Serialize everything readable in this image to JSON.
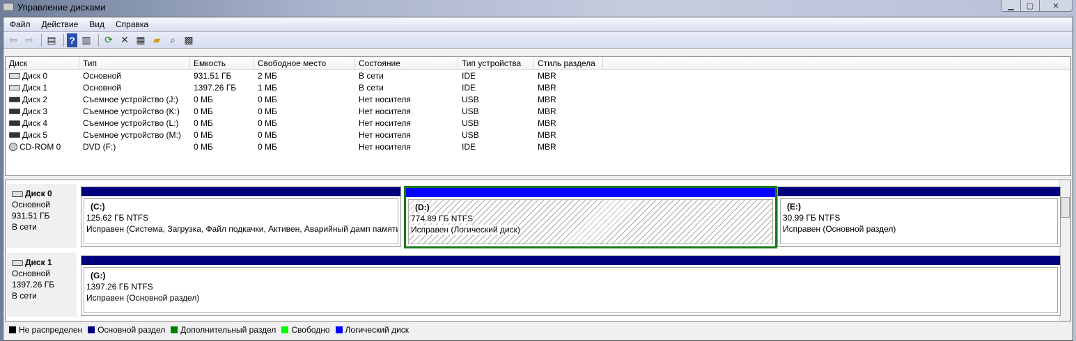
{
  "window": {
    "title": "Управление дисками",
    "controls": [
      "minimize",
      "maximize",
      "close"
    ]
  },
  "menu": [
    "Файл",
    "Действие",
    "Вид",
    "Справка"
  ],
  "toolbar": [
    "back-icon",
    "forward-icon",
    "console-tree-icon",
    "help-icon",
    "action-pane-icon",
    "refresh-icon",
    "delete-icon",
    "properties-icon",
    "open-icon",
    "search-icon",
    "settings-icon"
  ],
  "table": {
    "columns": [
      "Диск",
      "Тип",
      "Емкость",
      "Свободное место",
      "Состояние",
      "Тип устройства",
      "Стиль раздела"
    ],
    "rows": [
      [
        "Диск 0",
        "Основной",
        "931.51 ГБ",
        "2 МБ",
        "В сети",
        "IDE",
        "MBR"
      ],
      [
        "Диск 1",
        "Основной",
        "1397.26 ГБ",
        "1 МБ",
        "В сети",
        "IDE",
        "MBR"
      ],
      [
        "Диск 2",
        "Съемное устройство (J:)",
        "0 МБ",
        "0 МБ",
        "Нет носителя",
        "USB",
        "MBR"
      ],
      [
        "Диск 3",
        "Съемное устройство (K:)",
        "0 МБ",
        "0 МБ",
        "Нет носителя",
        "USB",
        "MBR"
      ],
      [
        "Диск 4",
        "Съемное устройство (L:)",
        "0 МБ",
        "0 МБ",
        "Нет носителя",
        "USB",
        "MBR"
      ],
      [
        "Диск 5",
        "Съемное устройство (M:)",
        "0 МБ",
        "0 МБ",
        "Нет носителя",
        "USB",
        "MBR"
      ],
      [
        "CD-ROM 0",
        "DVD (F:)",
        "0 МБ",
        "0 МБ",
        "Нет носителя",
        "IDE",
        "MBR"
      ]
    ]
  },
  "disks": [
    {
      "name": "Диск 0",
      "type": "Основной",
      "size": "931.51 ГБ",
      "status": "В сети",
      "partitions": [
        {
          "letter": "(C:)",
          "size": "125.62 ГБ NTFS",
          "status": "Исправен (Система, Загрузка, Файл подкачки, Активен, Аварийный дамп памяти,"
        },
        {
          "letter": "(D:)",
          "size": "774.89 ГБ NTFS",
          "status": "Исправен (Логический диск)",
          "selected": true
        },
        {
          "letter": "(E:)",
          "size": "30.99 ГБ NTFS",
          "status": "Исправен (Основной раздел)"
        }
      ]
    },
    {
      "name": "Диск 1",
      "type": "Основной",
      "size": "1397.26 ГБ",
      "status": "В сети",
      "partitions": [
        {
          "letter": "(G:)",
          "size": "1397.26 ГБ NTFS",
          "status": "Исправен (Основной раздел)"
        }
      ]
    }
  ],
  "legend": [
    {
      "label": "Не распределен",
      "color": "#000000"
    },
    {
      "label": "Основной раздел",
      "color": "#00007f"
    },
    {
      "label": "Дополнительный раздел",
      "color": "#007f00"
    },
    {
      "label": "Свободно",
      "color": "#00ff00"
    },
    {
      "label": "Логический диск",
      "color": "#0000ff"
    }
  ]
}
